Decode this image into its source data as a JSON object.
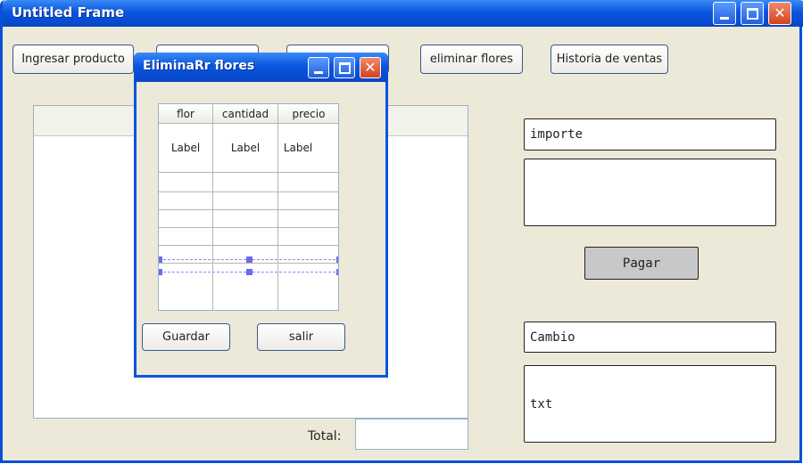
{
  "window": {
    "title": "Untitled Frame"
  },
  "toolbar": {
    "buttons": [
      {
        "label": "Ingresar producto"
      },
      {
        "label": ""
      },
      {
        "label": ""
      },
      {
        "label": "eliminar flores"
      },
      {
        "label": "Historia de ventas"
      }
    ]
  },
  "payment": {
    "importe_label": "importe",
    "pagar_label": "Pagar",
    "cambio_label": "Cambio",
    "output_text": "txt"
  },
  "total": {
    "label": "Total:",
    "value": ""
  },
  "dialog": {
    "title": "EliminaRr flores",
    "columns": [
      "flor",
      "cantidad",
      "precio"
    ],
    "first_row": [
      "Label",
      "Label",
      "Label"
    ],
    "save_label": "Guardar",
    "exit_label": "salir"
  },
  "colors": {
    "titlebar": "#0a55e0",
    "frame_bg": "#ece9d8",
    "close_button": "#d5421e"
  }
}
